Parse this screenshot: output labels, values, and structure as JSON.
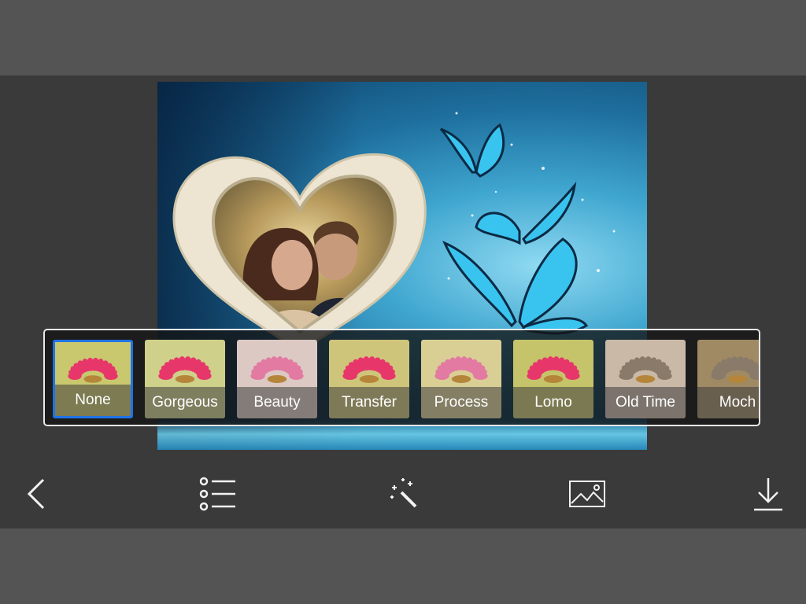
{
  "filters": {
    "selected_index": 0,
    "items": [
      {
        "label": "None",
        "tint": "#c9c86e"
      },
      {
        "label": "Gorgeous",
        "tint": "#cfd08a"
      },
      {
        "label": "Beauty",
        "tint": "#dcc9c4"
      },
      {
        "label": "Transfer",
        "tint": "#cfc57a"
      },
      {
        "label": "Process",
        "tint": "#d9cf95"
      },
      {
        "label": "Lomo",
        "tint": "#c6c46a"
      },
      {
        "label": "Old Time",
        "tint": "#c9b9a6"
      },
      {
        "label": "Moch",
        "tint": "#a08a64"
      }
    ]
  },
  "toolbar": {
    "icons": [
      "back-icon",
      "list-icon",
      "magic-wand-icon",
      "image-icon",
      "download-icon"
    ]
  },
  "colors": {
    "accent": "#1e73e8",
    "toolbar_bg": "#3a3a3a",
    "frame_bg": "#545454"
  }
}
